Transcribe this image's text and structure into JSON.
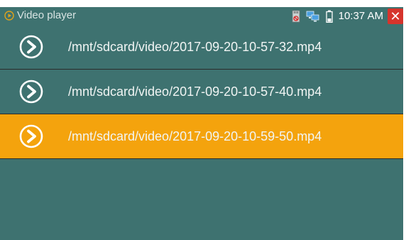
{
  "status_bar": {
    "app_title": "Video player",
    "time": "10:37 AM",
    "icons": [
      "sd-card-icon",
      "network-icon",
      "battery-icon",
      "close-icon"
    ]
  },
  "files": [
    {
      "path": "/mnt/sdcard/video/2017-09-20-10-57-32.mp4",
      "selected": false
    },
    {
      "path": "/mnt/sdcard/video/2017-09-20-10-57-40.mp4",
      "selected": false
    },
    {
      "path": "/mnt/sdcard/video/2017-09-20-10-59-50.mp4",
      "selected": true
    }
  ],
  "colors": {
    "background": "#3e7270",
    "selected_row": "#f4a30d",
    "close_button": "#d6342c"
  }
}
